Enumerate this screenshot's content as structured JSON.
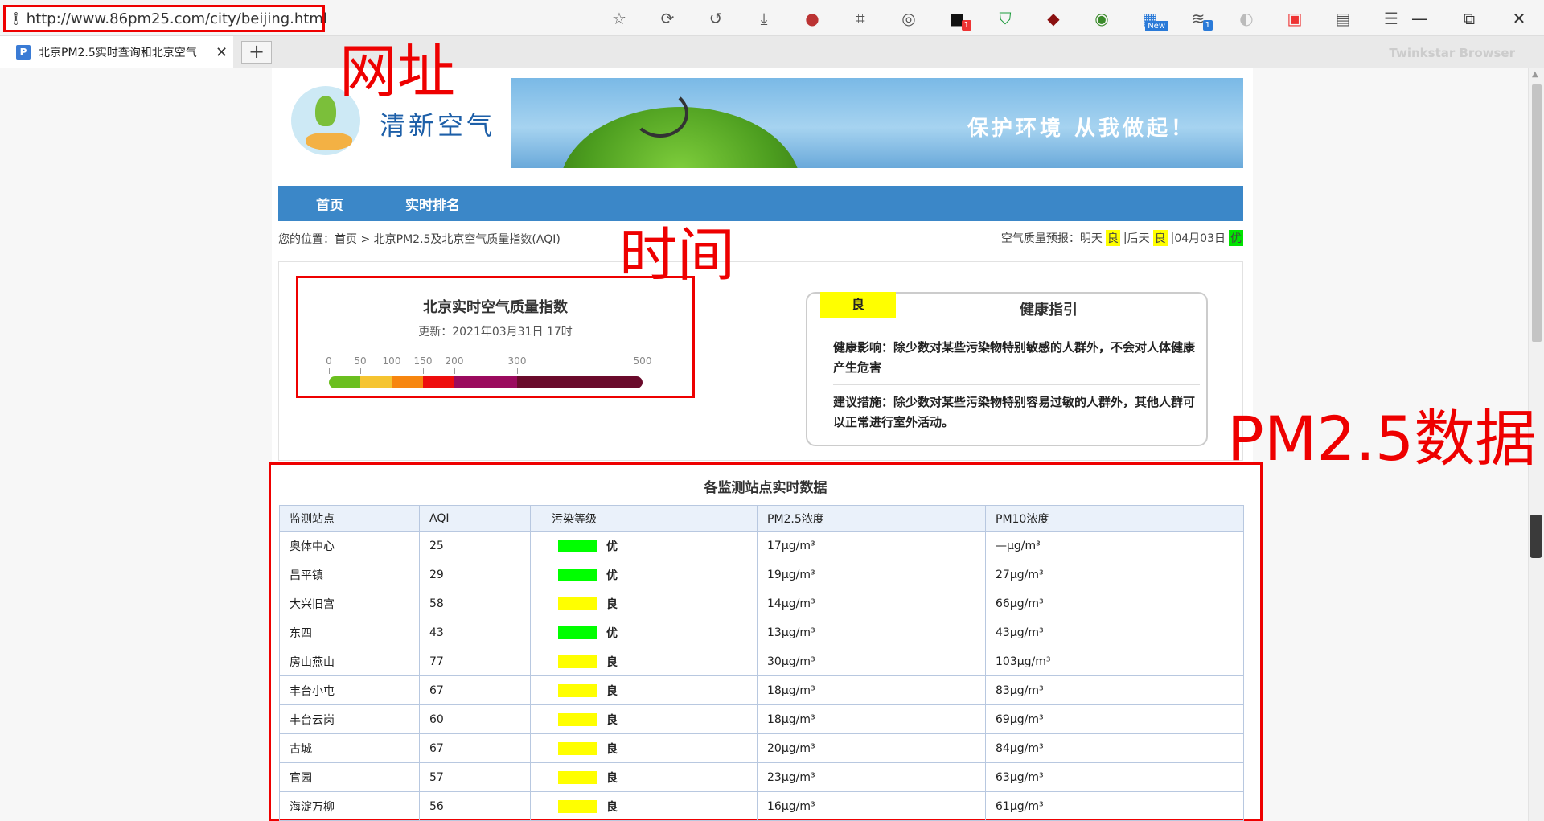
{
  "browser": {
    "url": "http://www.86pm25.com/city/beijing.html",
    "tab_title": "北京PM2.5实时查询和北京空气",
    "tab_favicon": "P",
    "new_tab": "+",
    "brand": "Twinkstar Browser",
    "toolbar_icons": [
      "star-icon",
      "refresh-icon",
      "undo-icon",
      "download-icon",
      "extension-icon",
      "crop-icon",
      "screenshot-icon",
      "extension-badge-icon",
      "shield-icon",
      "ublock-icon",
      "globe-icon",
      "new-extension-icon",
      "translate-icon",
      "disabled-icon",
      "camera-icon",
      "reader-icon",
      "menu-icon"
    ],
    "badge_1": "1",
    "badge_new": "New",
    "badge_2": "1",
    "window_controls": [
      "minimize-icon",
      "restore-icon",
      "close-icon"
    ]
  },
  "site": {
    "logo_text": "清新空气",
    "banner_slogan": "保护环境 从我做起！",
    "nav": [
      "首页",
      "实时排名"
    ]
  },
  "breadcrumb": {
    "prefix": "您的位置：",
    "home": "首页",
    "sep": " > ",
    "current": "北京PM2.5及北京空气质量指数(AQI)"
  },
  "forecast": {
    "label": "空气质量预报：",
    "d1_label": "明天",
    "d1_level": "良",
    "sep1": " | ",
    "d2_label": "后天",
    "d2_level": "良",
    "sep2": " | ",
    "d3_label": "04月03日",
    "d3_level": "优"
  },
  "aqi": {
    "title": "北京实时空气质量指数",
    "updated": "更新：2021年03月31日 17时",
    "ticks": [
      "0",
      "50",
      "100",
      "150",
      "200",
      "300",
      "500"
    ],
    "tick_values": [
      0,
      50,
      100,
      150,
      200,
      300,
      500
    ],
    "segments": [
      {
        "to": 50,
        "color": "#6bbf1f"
      },
      {
        "to": 100,
        "color": "#f5c431"
      },
      {
        "to": 150,
        "color": "#f7860f"
      },
      {
        "to": 200,
        "color": "#ee0d0d"
      },
      {
        "to": 300,
        "color": "#9b0a5e"
      },
      {
        "to": 500,
        "color": "#6a0a2b"
      }
    ]
  },
  "health": {
    "level": "良",
    "title": "健康指引",
    "effect": "健康影响：除少数对某些污染物特别敏感的人群外，不会对人体健康产生危害",
    "advice": "建议措施：除少数对某些污染物特别容易过敏的人群外，其他人群可以正常进行室外活动。"
  },
  "stations": {
    "title": "各监测站点实时数据",
    "headers": [
      "监测站点",
      "AQI",
      "污染等级",
      "PM2.5浓度",
      "PM10浓度"
    ],
    "rows": [
      {
        "name": "奥体中心",
        "aqi": "25",
        "level": "优",
        "color": "#00ff00",
        "pm25": "17μg/m³",
        "pm10": "—μg/m³"
      },
      {
        "name": "昌平镇",
        "aqi": "29",
        "level": "优",
        "color": "#00ff00",
        "pm25": "19μg/m³",
        "pm10": "27μg/m³"
      },
      {
        "name": "大兴旧宫",
        "aqi": "58",
        "level": "良",
        "color": "#ffff00",
        "pm25": "14μg/m³",
        "pm10": "66μg/m³"
      },
      {
        "name": "东四",
        "aqi": "43",
        "level": "优",
        "color": "#00ff00",
        "pm25": "13μg/m³",
        "pm10": "43μg/m³"
      },
      {
        "name": "房山燕山",
        "aqi": "77",
        "level": "良",
        "color": "#ffff00",
        "pm25": "30μg/m³",
        "pm10": "103μg/m³"
      },
      {
        "name": "丰台小屯",
        "aqi": "67",
        "level": "良",
        "color": "#ffff00",
        "pm25": "18μg/m³",
        "pm10": "83μg/m³"
      },
      {
        "name": "丰台云岗",
        "aqi": "60",
        "level": "良",
        "color": "#ffff00",
        "pm25": "18μg/m³",
        "pm10": "69μg/m³"
      },
      {
        "name": "古城",
        "aqi": "67",
        "level": "良",
        "color": "#ffff00",
        "pm25": "20μg/m³",
        "pm10": "84μg/m³"
      },
      {
        "name": "官园",
        "aqi": "57",
        "level": "良",
        "color": "#ffff00",
        "pm25": "23μg/m³",
        "pm10": "63μg/m³"
      },
      {
        "name": "海淀万柳",
        "aqi": "56",
        "level": "良",
        "color": "#ffff00",
        "pm25": "16μg/m³",
        "pm10": "61μg/m³"
      }
    ]
  },
  "annotations": {
    "url": "网址",
    "time": "时间",
    "pm": "PM2.5数据",
    "color": "#ee0000"
  }
}
